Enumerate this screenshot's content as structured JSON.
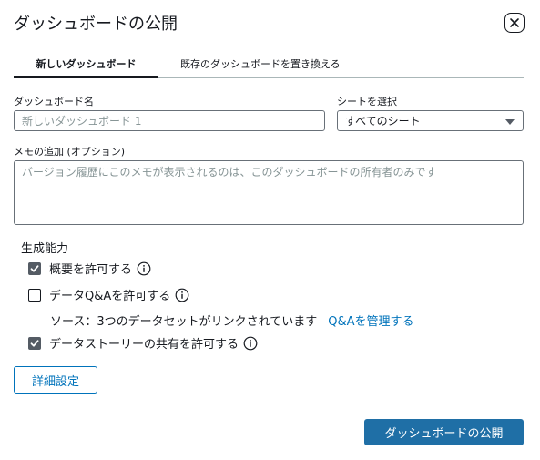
{
  "dialog": {
    "title": "ダッシュボードの公開"
  },
  "tabs": [
    {
      "label": "新しいダッシュボード",
      "active": true
    },
    {
      "label": "既存のダッシュボードを置き換える",
      "active": false
    }
  ],
  "form": {
    "name_label": "ダッシュボード名",
    "name_placeholder": "新しいダッシュボード 1",
    "sheet_label": "シートを選択",
    "sheet_value": "すべてのシート",
    "memo_label": "メモの追加 (オプション)",
    "memo_placeholder": "バージョン履歴にこのメモが表示されるのは、このダッシュボードの所有者のみです"
  },
  "capabilities": {
    "heading": "生成能力",
    "items": [
      {
        "label": "概要を許可する",
        "checked": true
      },
      {
        "label": "データQ&Aを許可する",
        "checked": false
      },
      {
        "label": "データストーリーの共有を許可する",
        "checked": true
      }
    ],
    "source_text": "ソース：3つのデータセットがリンクされています",
    "manage_link": "Q&Aを管理する"
  },
  "buttons": {
    "advanced": "詳細設定",
    "publish": "ダッシュボードの公開"
  },
  "colors": {
    "primary": "#1f6fa6",
    "link": "#0073bb",
    "checkbox": "#545b64"
  },
  "icons": {
    "close": "close-icon",
    "info": "info-icon",
    "check": "check-icon",
    "dropdown": "caret-down-icon"
  }
}
